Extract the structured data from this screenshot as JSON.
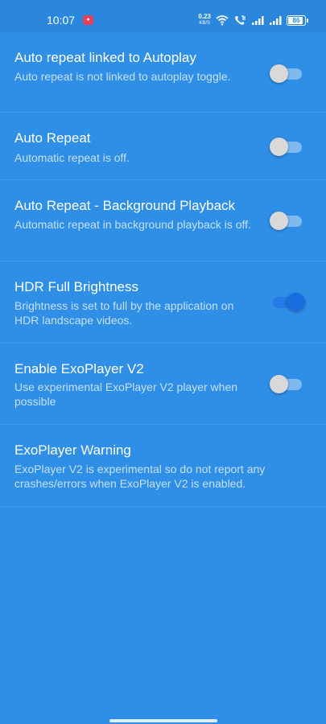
{
  "status_bar": {
    "time": "10:07",
    "record_icon": "screen-record-icon",
    "net_speed_value": "0.23",
    "net_speed_unit": "KB/S",
    "icons": [
      "wifi-icon",
      "volte-icon",
      "signal-icon",
      "signal-icon"
    ],
    "battery": "86"
  },
  "settings": [
    {
      "title": "Auto repeat linked to Autoplay",
      "summary": "Auto repeat is not linked to autoplay toggle.",
      "toggle_on": false
    },
    {
      "title": "Auto Repeat",
      "summary": "Automatic repeat is off.",
      "toggle_on": false
    },
    {
      "title": "Auto Repeat - Background Playback",
      "summary": "Automatic repeat in background playback is off.",
      "toggle_on": false
    },
    {
      "title": "HDR Full Brightness",
      "summary": "Brightness is set to full by the application on HDR landscape videos.",
      "toggle_on": true
    },
    {
      "title": "Enable ExoPlayer V2",
      "summary": "Use experimental ExoPlayer V2 player when possible",
      "toggle_on": false
    },
    {
      "title": "ExoPlayer Warning",
      "summary": "ExoPlayer V2 is experimental so do not report any crashes/errors when ExoPlayer V2 is enabled."
    }
  ],
  "colors": {
    "background": "#2f8fe6",
    "status_bar": "#2a87dd",
    "switch_on": "#1a6ee1",
    "switch_off_thumb": "#d9d9d9"
  }
}
